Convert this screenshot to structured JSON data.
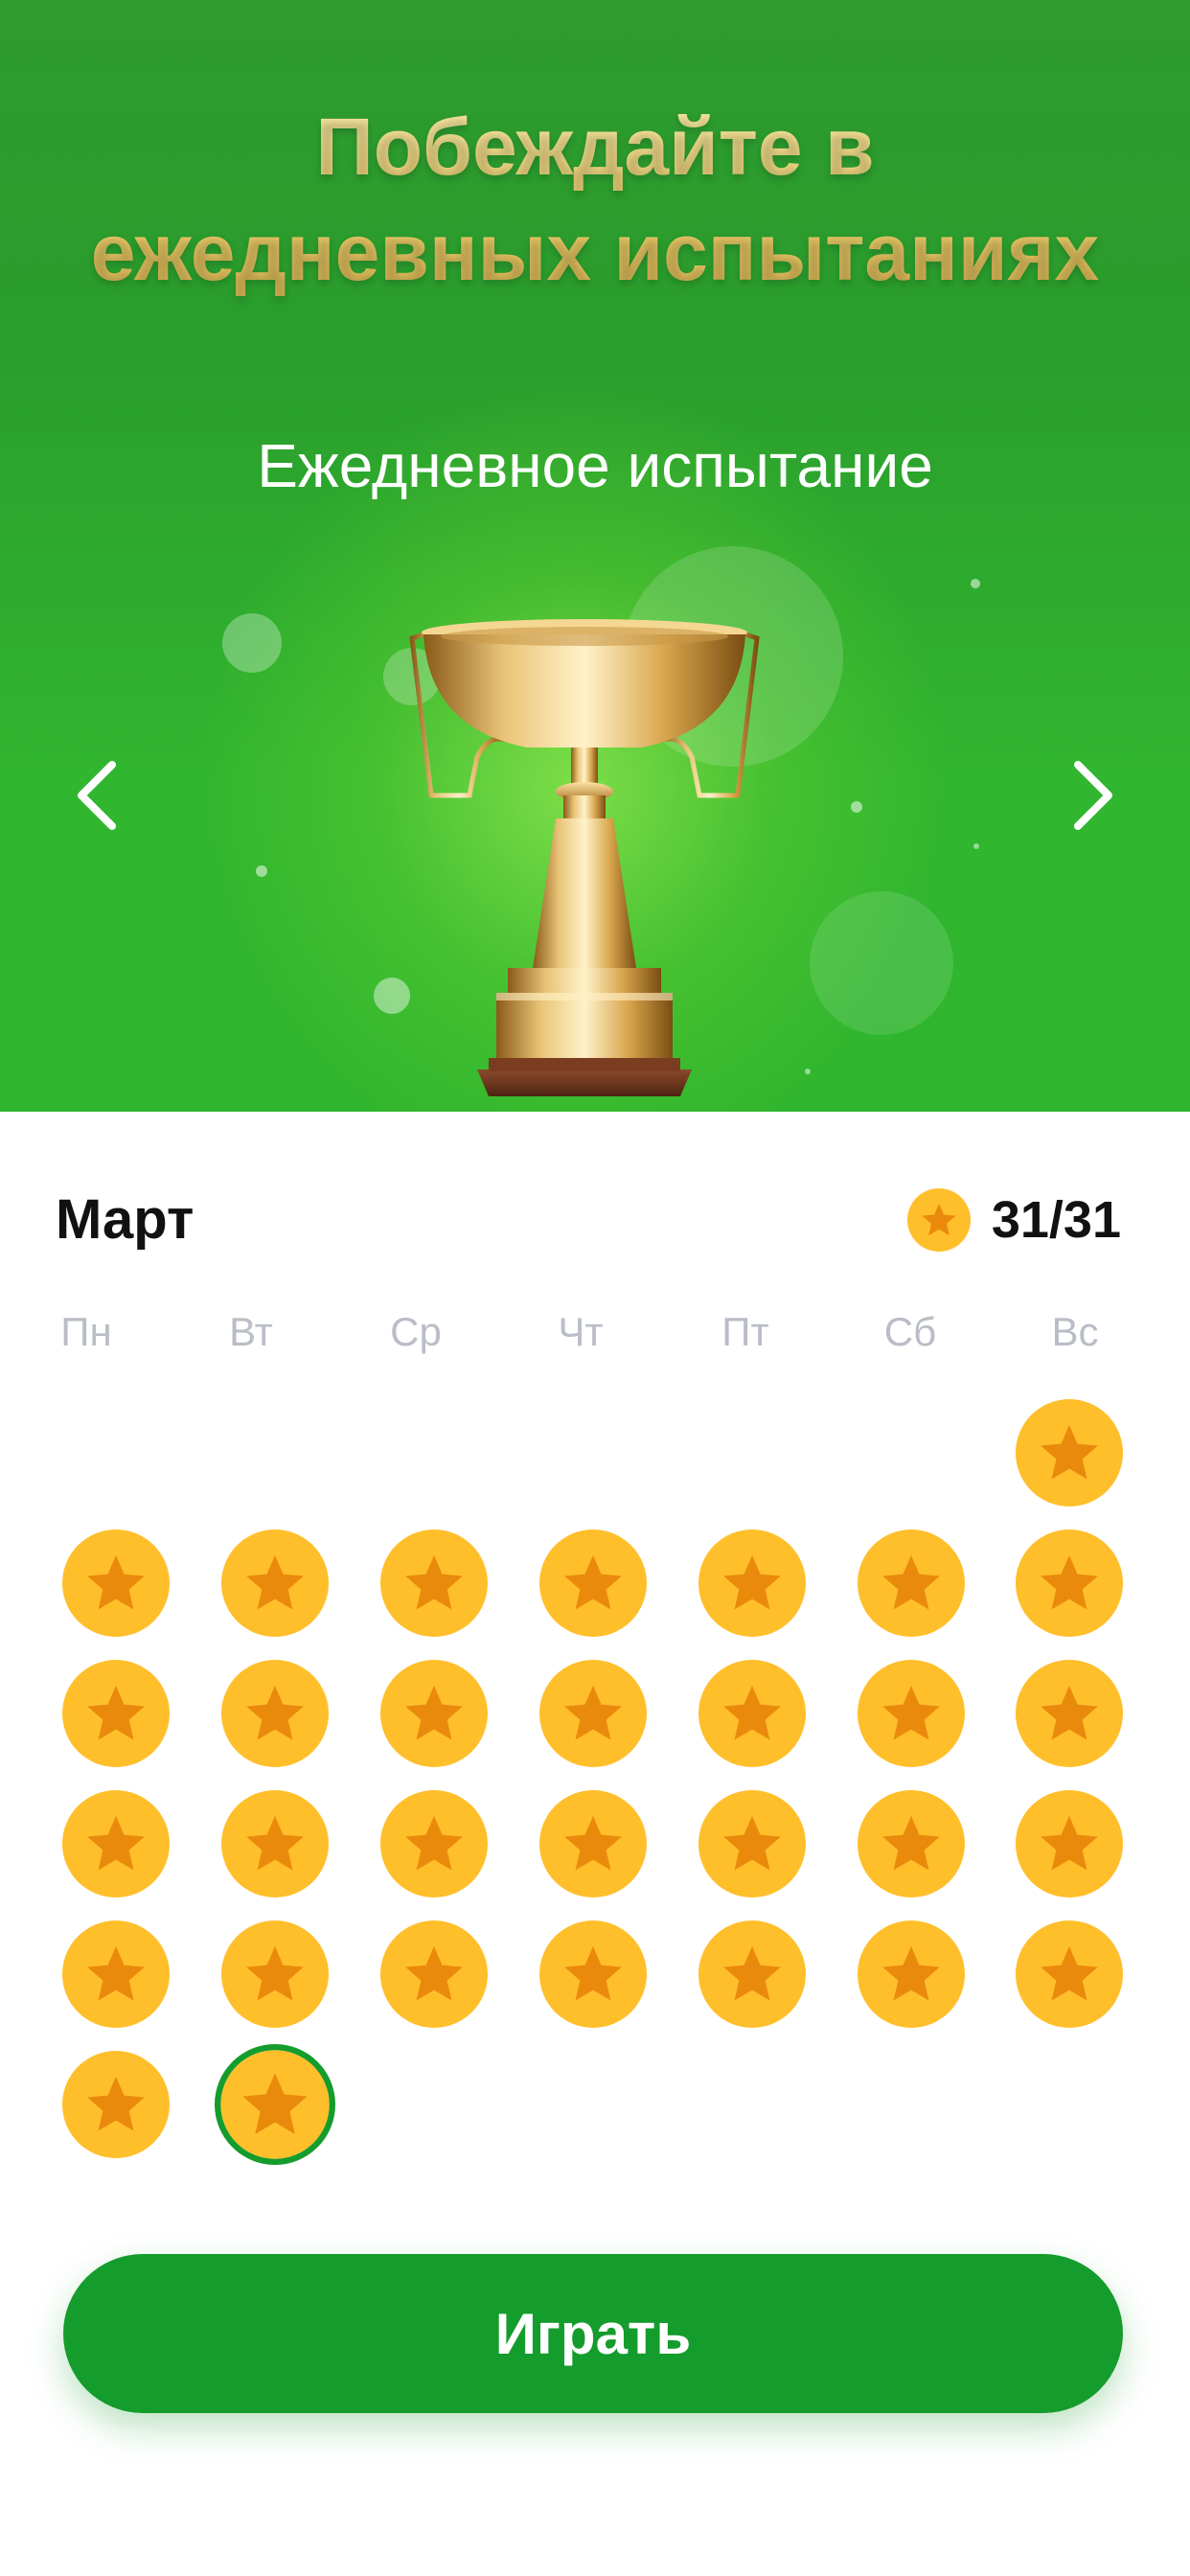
{
  "hero": {
    "title_line1": "Побеждайте в",
    "title_line2": "ежедневных испытаниях",
    "subtitle": "Ежедневное испытание",
    "prev_icon": "chevron-left-icon",
    "next_icon": "chevron-right-icon",
    "image_icon": "trophy-icon"
  },
  "calendar": {
    "month": "Март",
    "score": "31/31",
    "score_icon": "star-coin-icon",
    "weekdays": [
      "Пн",
      "Вт",
      "Ср",
      "Чт",
      "Пт",
      "Сб",
      "Вс"
    ],
    "first_day_column": 7,
    "days_completed": 31,
    "total_days": 31,
    "current_day": 31
  },
  "actions": {
    "play_label": "Играть"
  },
  "colors": {
    "coin": "#ffbf2b",
    "star": "#ea8a0d",
    "accent_green": "#149c2c",
    "hero_green": "#2fa82e",
    "title_gold": "#eed27a"
  }
}
